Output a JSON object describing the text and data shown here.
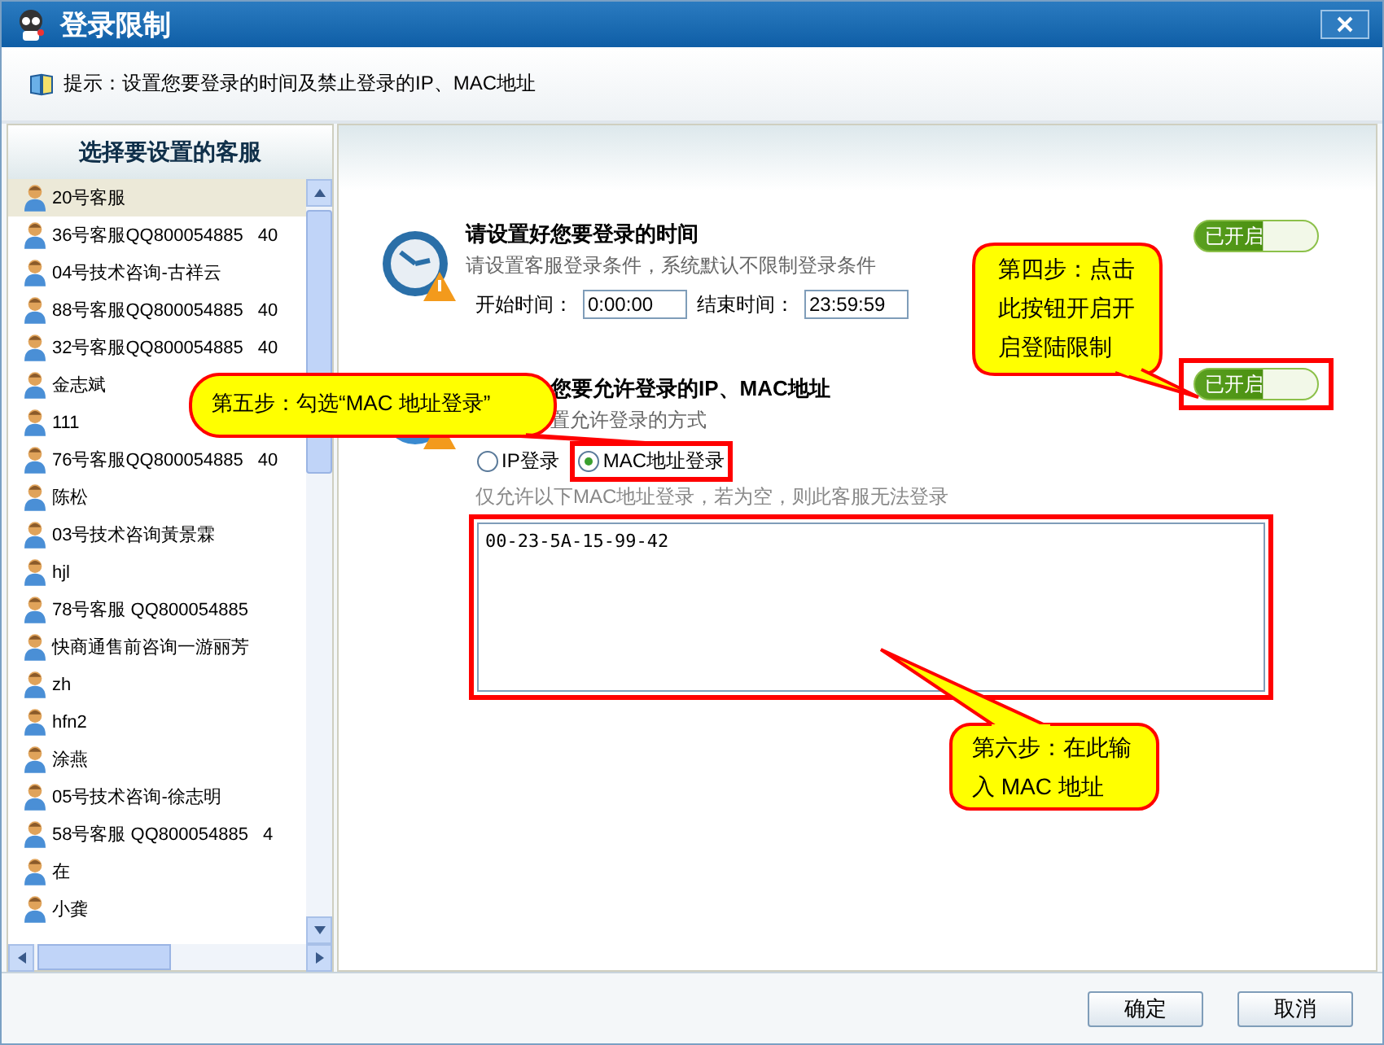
{
  "window": {
    "title": "登录限制"
  },
  "hint": "提示：设置您要登录的时间及禁止登录的IP、MAC地址",
  "agent_list": {
    "header": "选择要设置的客服",
    "items": [
      {
        "name": "20号客服",
        "selected": true
      },
      {
        "name": "36号客服QQ800054885",
        "extra": "40",
        "selected": false
      },
      {
        "name": "04号技术咨询-古祥云",
        "selected": false
      },
      {
        "name": "88号客服QQ800054885",
        "extra": "40",
        "selected": false
      },
      {
        "name": "32号客服QQ800054885",
        "extra": "40",
        "selected": false
      },
      {
        "name": "金志斌",
        "selected": false
      },
      {
        "name": "111",
        "selected": false
      },
      {
        "name": "76号客服QQ800054885",
        "extra": "40",
        "selected": false
      },
      {
        "name": "陈松",
        "selected": false
      },
      {
        "name": "03号技术咨询黃景霖",
        "selected": false
      },
      {
        "name": "hjl",
        "selected": false
      },
      {
        "name": "78号客服 QQ800054885",
        "selected": false
      },
      {
        "name": "快商通售前咨询一游丽芳",
        "selected": false
      },
      {
        "name": "zh",
        "selected": false
      },
      {
        "name": "hfn2",
        "selected": false
      },
      {
        "name": "涂燕",
        "selected": false
      },
      {
        "name": "05号技术咨询-徐志明",
        "selected": false
      },
      {
        "name": "58号客服 QQ800054885",
        "extra": "4",
        "selected": false
      },
      {
        "name": "在",
        "selected": false
      },
      {
        "name": "小龚",
        "selected": false
      }
    ]
  },
  "time_section": {
    "title": "请设置好您要登录的时间",
    "subtitle": "请设置客服登录条件，系统默认不限制登录条件",
    "start_label": "开始时间：",
    "start_value": "0:00:00",
    "end_label": "结束时间：",
    "end_value": "23:59:59",
    "toggle": {
      "label": "已开启",
      "on": true,
      "highlighted": false
    }
  },
  "address_section": {
    "title": "您要允许登录的IP、MAC地址",
    "subtitle": "置允许登录的方式",
    "options": [
      {
        "label": "IP登录",
        "selected": false,
        "highlighted": false
      },
      {
        "label": "MAC地址登录",
        "selected": true,
        "highlighted": true
      }
    ],
    "note": "仅允许以下MAC地址登录，若为空，则此客服无法登录",
    "addresses": "00-23-5A-15-99-42",
    "addresses_highlighted": true,
    "toggle": {
      "label": "已开启",
      "on": true,
      "highlighted": true
    }
  },
  "callouts": [
    "第四步：点击此按钮开启开启登陆限制",
    "第五步：勾选“MAC 地址登录”",
    "第六步：在此输入 MAC 地址"
  ],
  "buttons": [
    "确定",
    "取消"
  ]
}
